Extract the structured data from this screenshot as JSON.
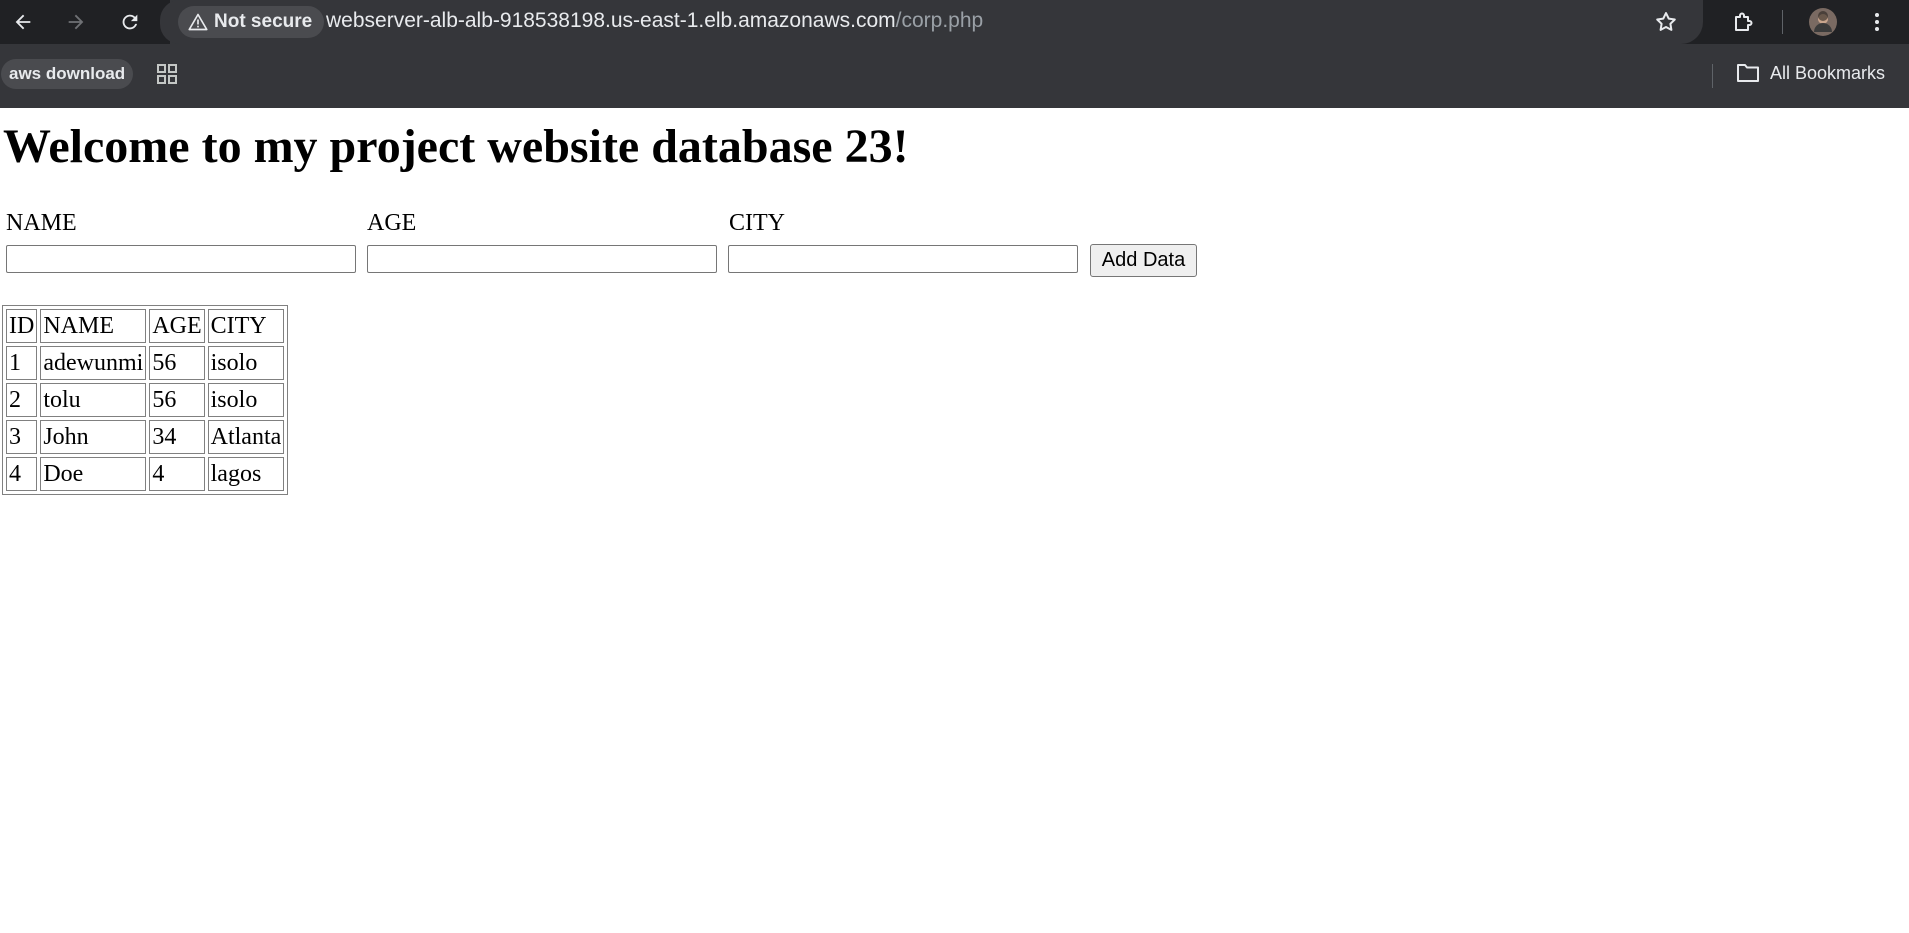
{
  "browser": {
    "security_label": "Not secure",
    "url_host": "webserver-alb-alb-918538198.us-east-1.elb.amazonaws.com",
    "url_path": "/corp.php",
    "bookmarks": [
      {
        "label": "aws download"
      }
    ],
    "all_bookmarks_label": "All Bookmarks"
  },
  "page": {
    "heading": "Welcome to my project website database 23!",
    "form": {
      "name_label": "NAME",
      "age_label": "AGE",
      "city_label": "CITY",
      "name_value": "",
      "age_value": "",
      "city_value": "",
      "submit_label": "Add Data"
    },
    "table": {
      "headers": [
        "ID",
        "NAME",
        "AGE",
        "CITY"
      ],
      "rows": [
        [
          "1",
          "adewunmi",
          "56",
          "isolo"
        ],
        [
          "2",
          "tolu",
          "56",
          "isolo"
        ],
        [
          "3",
          "John",
          "34",
          "Atlanta"
        ],
        [
          "4",
          "Doe",
          "4",
          "lagos"
        ]
      ]
    }
  }
}
